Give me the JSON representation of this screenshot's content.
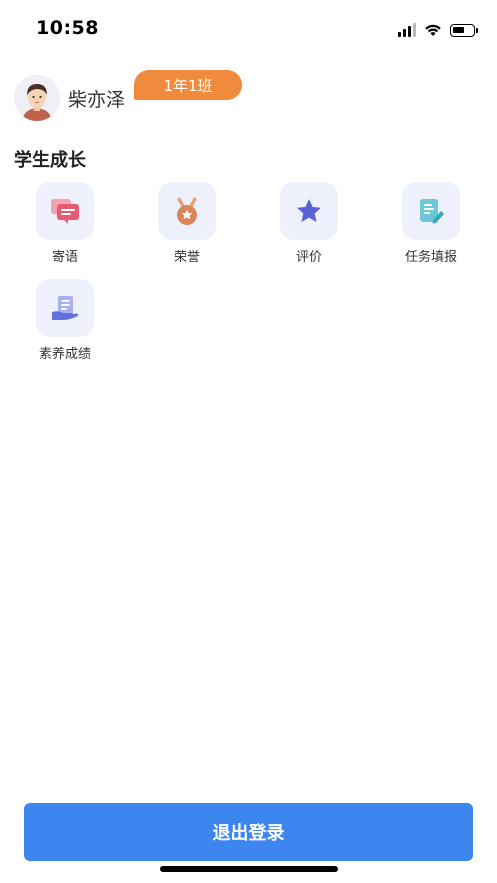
{
  "status_bar": {
    "time": "10:58",
    "icons": [
      "signal-icon",
      "wifi-icon",
      "battery-icon"
    ]
  },
  "profile": {
    "name": "柴亦泽",
    "class_badge": "1年1班",
    "avatar_icon": "avatar-boy-icon"
  },
  "section": {
    "title": "学生成长"
  },
  "grid_items": [
    {
      "label": "寄语",
      "icon": "message-icon",
      "color": "#e85a73"
    },
    {
      "label": "荣誉",
      "icon": "medal-icon",
      "color": "#d9875a"
    },
    {
      "label": "评价",
      "icon": "star-icon",
      "color": "#5b62d9"
    },
    {
      "label": "任务填报",
      "icon": "note-edit-icon",
      "color": "#6cc8d6"
    },
    {
      "label": "素养成绩",
      "icon": "certificate-icon",
      "color": "#6270e0"
    }
  ],
  "logout": {
    "label": "退出登录"
  },
  "colors": {
    "accent": "#3d86f0",
    "badge": "#f08a3c",
    "tile_bg": "#eef1fb"
  }
}
